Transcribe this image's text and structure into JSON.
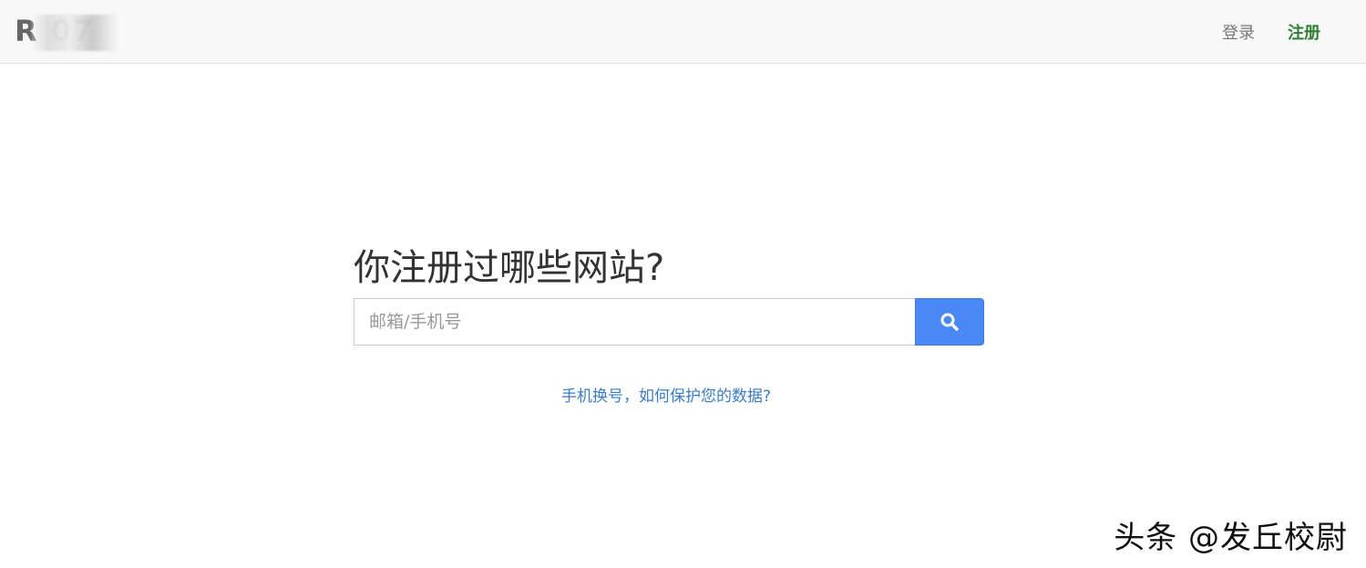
{
  "navbar": {
    "brand_text": "R  07",
    "login_label": "登录",
    "register_label": "注册",
    "register_color": "#2e7d32"
  },
  "main": {
    "title": "你注册过哪些网站?",
    "search": {
      "placeholder": "邮箱/手机号",
      "value": "",
      "button_icon": "search-icon",
      "button_color": "#4a89f3"
    },
    "help_link": "手机换号，如何保护您的数据?"
  },
  "watermark": {
    "text": "头条 @发丘校尉"
  }
}
